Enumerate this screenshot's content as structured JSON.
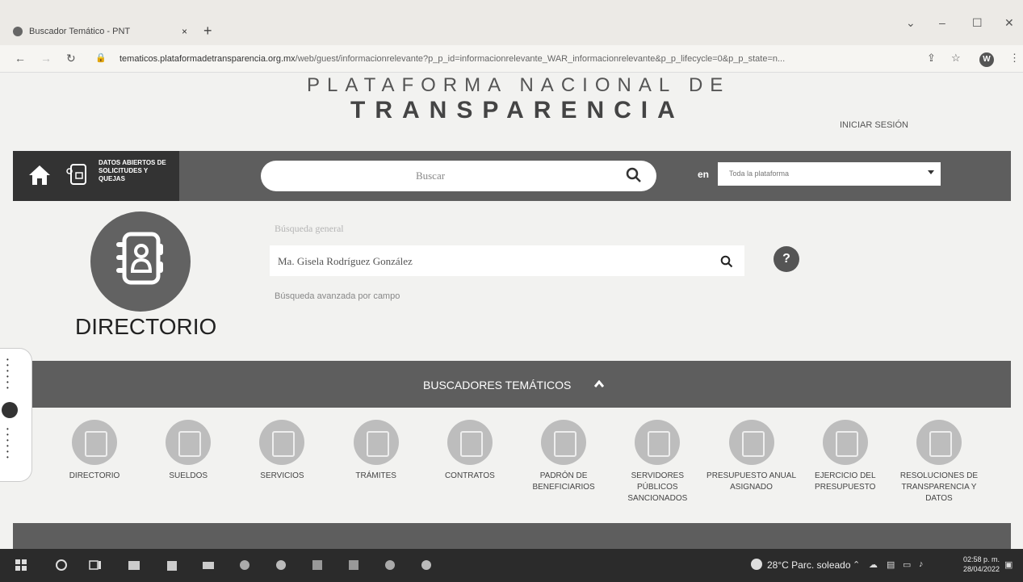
{
  "browser": {
    "tab_title": "Buscador Temático - PNT",
    "tab_close": "×",
    "new_tab": "+",
    "url_host": "tematicos.plataformadetransparencia.org.mx",
    "url_path": "/web/guest/informacionrelevante?p_p_id=informacionrelevante_WAR_informacionrelevante&p_p_lifecycle=0&p_p_state=n...",
    "profile_initial": "W"
  },
  "header": {
    "brand_line1": "PLATAFORMA NACIONAL DE",
    "brand_line2": "TRANSPARENCIA",
    "login": "INICIAR SESIÓN"
  },
  "navbar": {
    "datos_label": "DATOS ABIERTOS DE SOLICITUDES Y QUEJAS",
    "search_placeholder": "Buscar",
    "en_label": "en",
    "scope_value": "Toda la plataforma"
  },
  "directorio": {
    "title": "DIRECTORIO",
    "general_label": "Búsqueda general",
    "query_value": "Ma. Gisela Rodríguez González",
    "help": "?",
    "advanced_link": "Búsqueda avanzada por campo"
  },
  "thematic": {
    "label": "BUSCADORES TEMÁTICOS",
    "items": [
      {
        "label": "DIRECTORIO"
      },
      {
        "label": "SUELDOS"
      },
      {
        "label": "SERVICIOS"
      },
      {
        "label": "TRÁMITES"
      },
      {
        "label": "CONTRATOS"
      },
      {
        "label": "PADRÓN DE BENEFICIARIOS"
      },
      {
        "label": "SERVIDORES PÚBLICOS SANCIONADOS"
      },
      {
        "label": "PRESUPUESTO ANUAL ASIGNADO"
      },
      {
        "label": "EJERCICIO DEL PRESUPUESTO"
      },
      {
        "label": "RESOLUCIONES DE TRANSPARENCIA Y DATOS"
      }
    ]
  },
  "taskbar": {
    "weather": "28°C  Parc. soleado",
    "time": "02:58 p. m.",
    "date": "28/04/2022"
  },
  "colors": {
    "navbar": "#5e5e5e",
    "home_box": "#333333",
    "circle": "#626262",
    "theme_circle": "#bdbdbd",
    "taskbar": "#2b2b2b"
  }
}
